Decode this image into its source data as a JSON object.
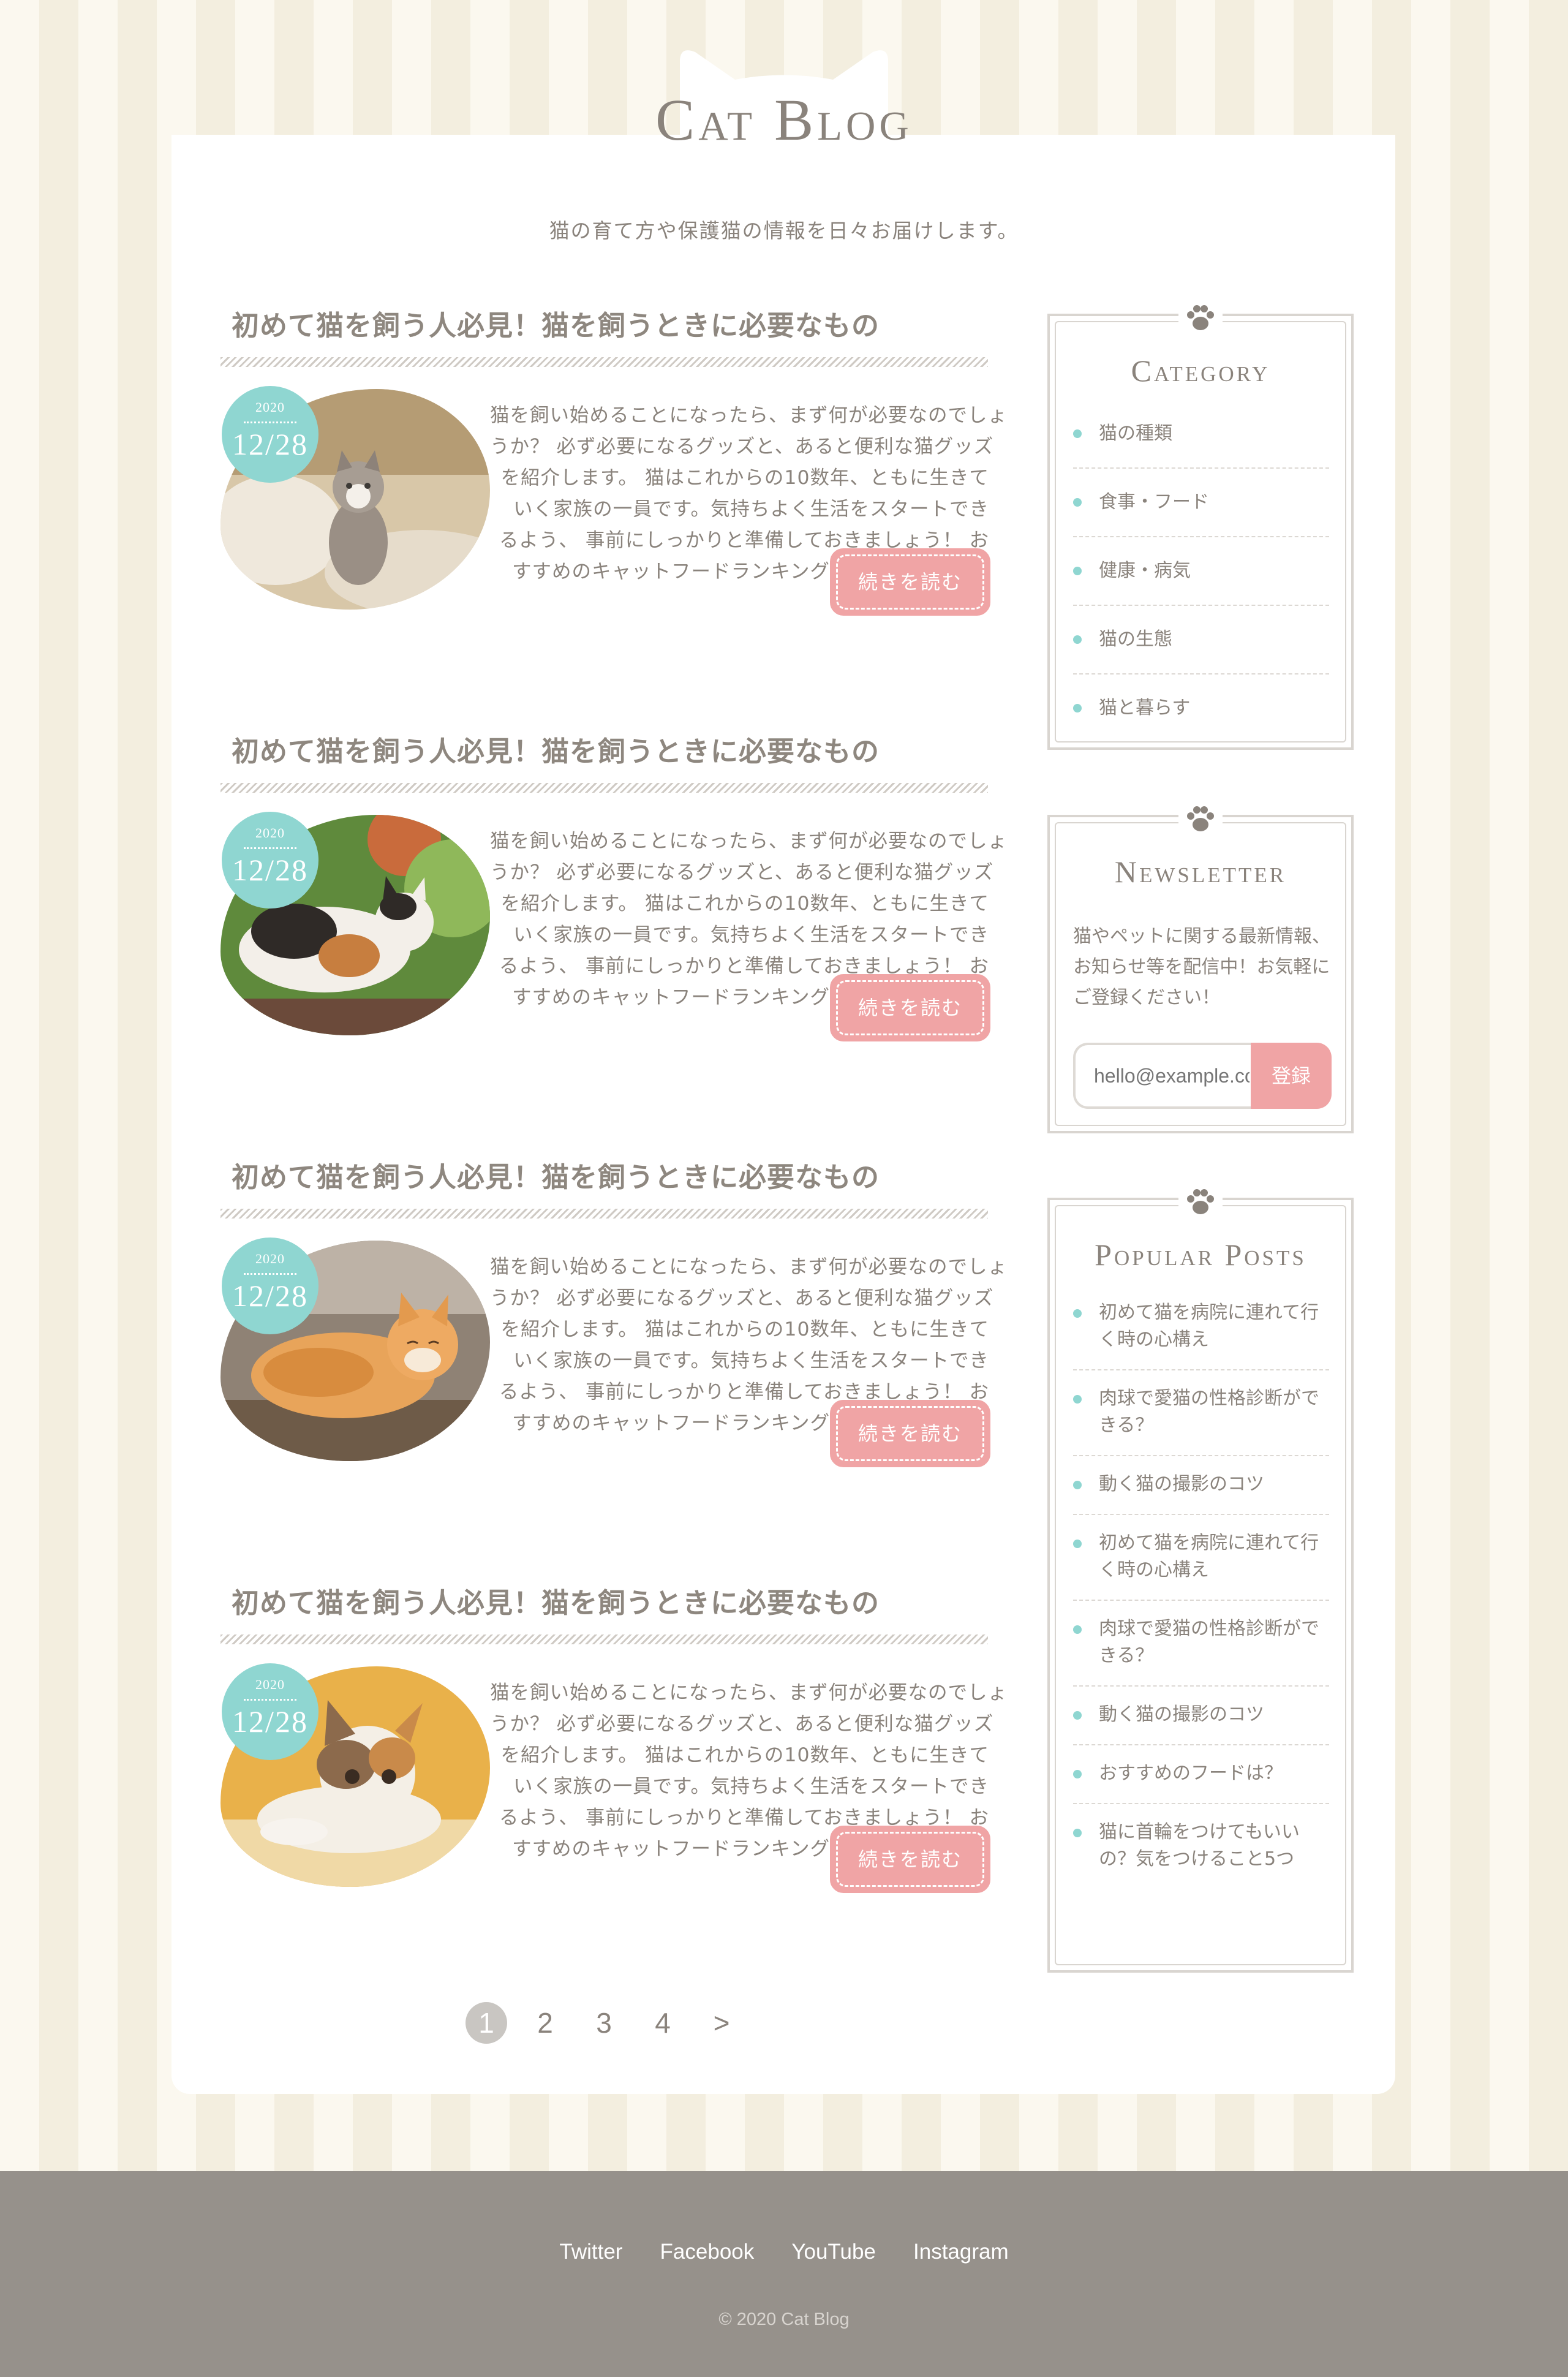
{
  "header": {
    "site_title": "Cat Blog",
    "tagline": "猫の育て方や保護猫の情報を日々お届けします。"
  },
  "posts": [
    {
      "title": "初めて猫を飼う人必見！猫を飼うときに必要なもの",
      "date_year": "2020",
      "date_day": "12/28",
      "image": "kitten-on-cushion",
      "excerpt_lines": [
        "猫を飼い始めることになったら、まず何が必要なのでしょ",
        "うか？ 必ず必要になるグッズと、あると便利な猫グッズ",
        "を紹介します。 猫はこれからの10数年、ともに生きて",
        "いく家族の一員です。気持ちよく生活をスタートでき",
        "るよう、 事前にしっかりと準備しておきましょう！ お",
        "すすめのキャットフードランキングもまとめました！"
      ],
      "more_label": "続きを読む"
    },
    {
      "title": "初めて猫を飼う人必見！猫を飼うときに必要なもの",
      "date_year": "2020",
      "date_day": "12/28",
      "image": "calico-cat-crouching",
      "excerpt_lines": [
        "猫を飼い始めることになったら、まず何が必要なのでしょ",
        "うか？ 必ず必要になるグッズと、あると便利な猫グッズ",
        "を紹介します。 猫はこれからの10数年、ともに生きて",
        "いく家族の一員です。気持ちよく生活をスタートでき",
        "るよう、 事前にしっかりと準備しておきましょう！ お",
        "すすめのキャットフードランキングもまとめました！"
      ],
      "more_label": "続きを読む"
    },
    {
      "title": "初めて猫を飼う人必見！猫を飼うときに必要なもの",
      "date_year": "2020",
      "date_day": "12/28",
      "image": "orange-tabby-sleeping",
      "excerpt_lines": [
        "猫を飼い始めることになったら、まず何が必要なのでしょ",
        "うか？ 必ず必要になるグッズと、あると便利な猫グッズ",
        "を紹介します。 猫はこれからの10数年、ともに生きて",
        "いく家族の一員です。気持ちよく生活をスタートでき",
        "るよう、 事前にしっかりと準備しておきましょう！ お",
        "すすめのキャットフードランキングもまとめました！"
      ],
      "more_label": "続きを読む"
    },
    {
      "title": "初めて猫を飼う人必見！猫を飼うときに必要なもの",
      "date_year": "2020",
      "date_day": "12/28",
      "image": "calico-kitten-lying",
      "excerpt_lines": [
        "猫を飼い始めることになったら、まず何が必要なのでしょ",
        "うか？ 必ず必要になるグッズと、あると便利な猫グッズ",
        "を紹介します。 猫はこれからの10数年、ともに生きて",
        "いく家族の一員です。気持ちよく生活をスタートでき",
        "るよう、 事前にしっかりと準備しておきましょう！ お",
        "すすめのキャットフードランキングもまとめました！"
      ],
      "more_label": "続きを読む"
    }
  ],
  "pagination": {
    "pages": [
      "1",
      "2",
      "3",
      "4"
    ],
    "current": "1",
    "next_label": ">"
  },
  "sidebar": {
    "category": {
      "title": "Category",
      "items": [
        "猫の種類",
        "食事・フード",
        "健康・病気",
        "猫の生態",
        "猫と暮らす"
      ]
    },
    "newsletter": {
      "title": "Newsletter",
      "text": "猫やペットに関する最新情報、お知らせ等を配信中！お気軽にご登録ください！",
      "placeholder": "hello@example.com",
      "button_label": "登録"
    },
    "popular": {
      "title": "Popular Posts",
      "items": [
        "初めて猫を病院に連れて行く時の心構え",
        "肉球で愛猫の性格診断ができる？",
        "動く猫の撮影のコツ",
        "初めて猫を病院に連れて行く時の心構え",
        "肉球で愛猫の性格診断ができる？",
        "動く猫の撮影のコツ",
        "おすすめのフードは？",
        "猫に首輪をつけてもいいの？気をつけること5つ"
      ]
    }
  },
  "footer": {
    "links": [
      "Twitter",
      "Facebook",
      "YouTube",
      "Instagram"
    ],
    "copyright": "© 2020 Cat Blog"
  },
  "colors": {
    "accent_teal": "#8fd6d1",
    "button_pink": "#f0a4a5",
    "text": "#8a837c",
    "footer_bg": "#96918b",
    "stripe_light": "#fbf8ef",
    "stripe_dark": "#f3eedf"
  },
  "icons": [
    "paw-icon"
  ]
}
